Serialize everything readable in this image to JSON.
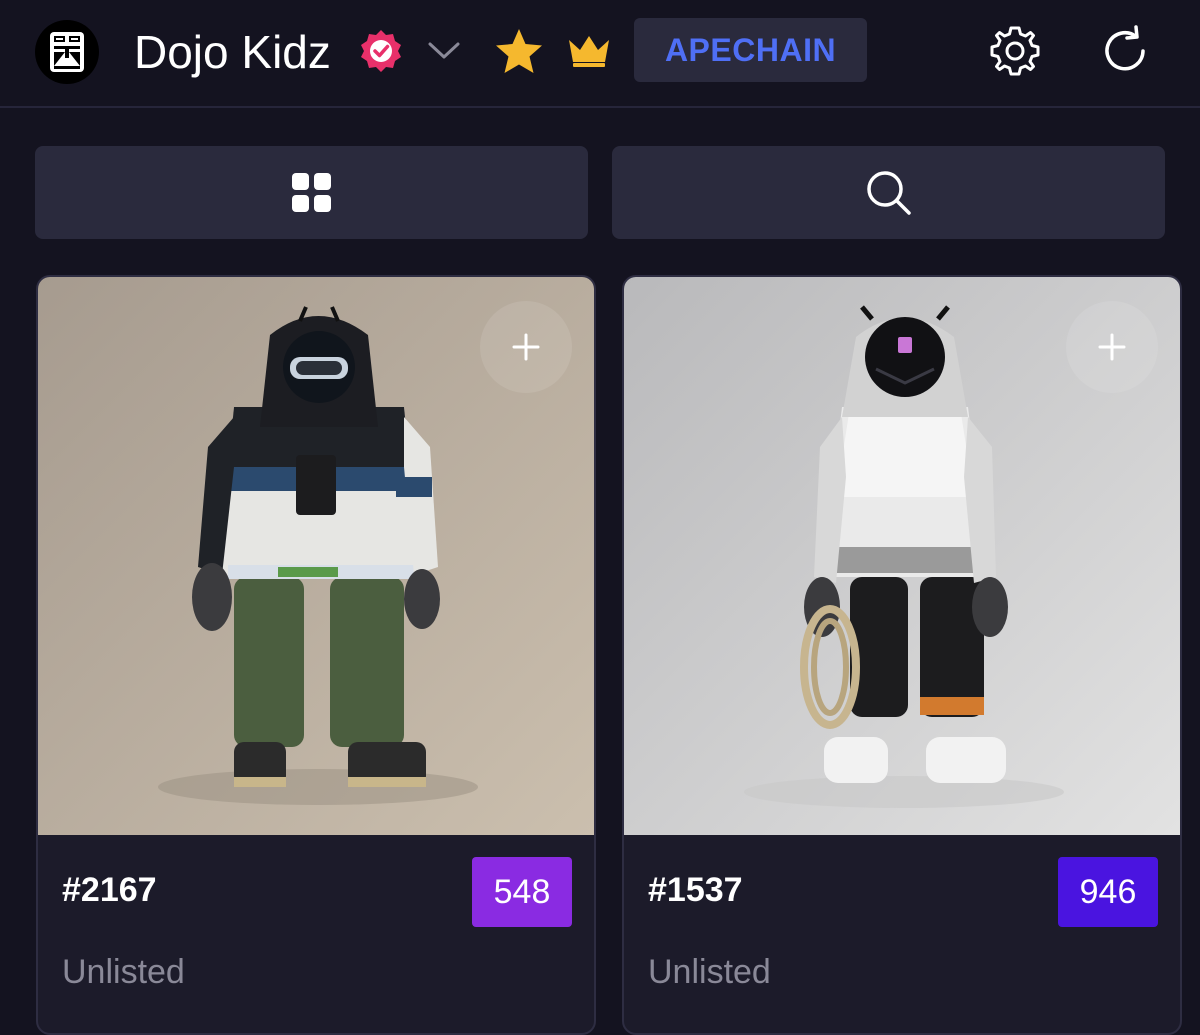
{
  "header": {
    "collection_name": "Dojo Kidz",
    "chain_label": "APECHAIN",
    "icons": [
      "dojo-logo",
      "verified-icon",
      "chevron-down-icon",
      "star-icon",
      "crown-icon",
      "gear-icon",
      "refresh-icon"
    ]
  },
  "toolbar": {
    "icons": [
      "grid-view-icon",
      "search-icon"
    ]
  },
  "colors": {
    "background": "#141320",
    "panel": "#2a2a3d",
    "chain_text": "#4f6ff5",
    "verified": "#e8306a",
    "star": "#f5b82e",
    "crown": "#f5b82e",
    "rank_548": "#8a2be2",
    "rank_946": "#4a14e0"
  },
  "cards": [
    {
      "id": "#2167",
      "rank": "548",
      "status": "Unlisted",
      "image": "hooded character with helmet, green pants"
    },
    {
      "id": "#1537",
      "rank": "946",
      "status": "Unlisted",
      "image": "hooded character with black mask, holding rope"
    }
  ]
}
